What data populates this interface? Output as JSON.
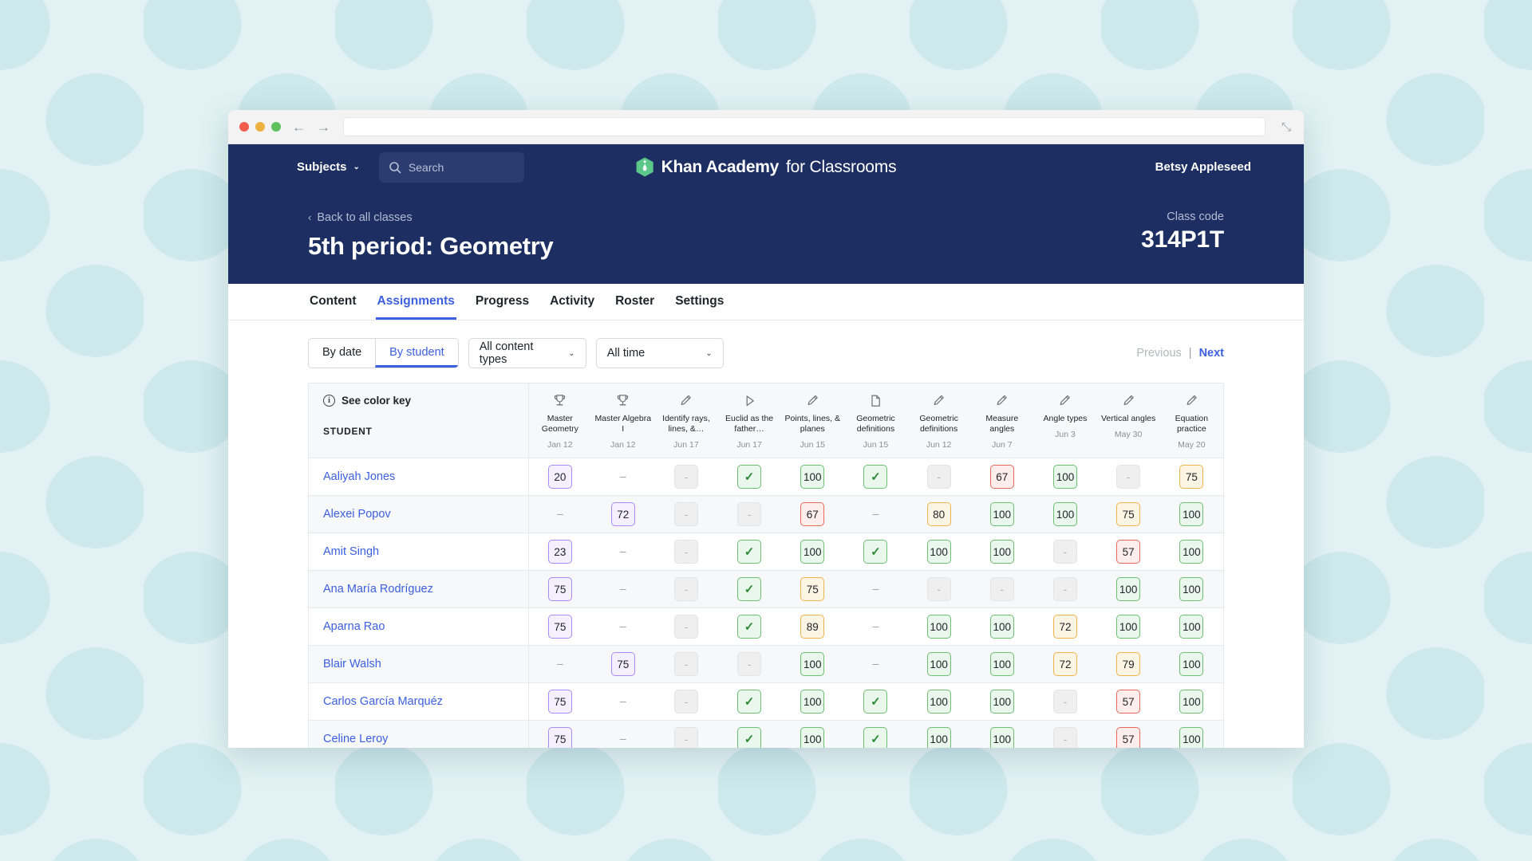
{
  "browser": {
    "traffic_lights": [
      "close-red",
      "minimize-yellow",
      "maximize-green"
    ],
    "back_arrow": "←",
    "forward_arrow": "→",
    "url_value": "",
    "expand_icon": "⤡"
  },
  "nav": {
    "subjects_label": "Subjects",
    "chevron": "⌄",
    "search_placeholder": "Search",
    "search_value": "",
    "brand_bold": "Khan Academy",
    "brand_light": "for Classrooms",
    "user_name": "Betsy Appleseed"
  },
  "class_header": {
    "back_chevron": "‹",
    "back_label": "Back to all classes",
    "title": "5th period: Geometry",
    "class_code_label": "Class code",
    "class_code_value": "314P1T"
  },
  "tabs": [
    {
      "label": "Content",
      "active": false
    },
    {
      "label": "Assignments",
      "active": true
    },
    {
      "label": "Progress",
      "active": false
    },
    {
      "label": "Activity",
      "active": false
    },
    {
      "label": "Roster",
      "active": false
    },
    {
      "label": "Settings",
      "active": false
    }
  ],
  "toolbar": {
    "by_date_label": "By date",
    "by_student_label": "By student",
    "content_type_value": "All content types",
    "time_value": "All time",
    "chevron": "⌄",
    "previous_label": "Previous",
    "separator": "|",
    "next_label": "Next"
  },
  "table": {
    "color_key_label": "See color key",
    "info_icon_glyph": "i",
    "student_column_label": "STUDENT",
    "columns": [
      {
        "icon": "trophy-icon",
        "name": "Master Geometry",
        "date": "Jan 12"
      },
      {
        "icon": "trophy-icon",
        "name": "Master Algebra I",
        "date": "Jan 12"
      },
      {
        "icon": "pencil-icon",
        "name": "Identify rays, lines, &…",
        "date": "Jun 17"
      },
      {
        "icon": "play-icon",
        "name": "Euclid as the father…",
        "date": "Jun 17"
      },
      {
        "icon": "pencil-icon",
        "name": "Points, lines, & planes",
        "date": "Jun 15"
      },
      {
        "icon": "article-icon",
        "name": "Geometric definitions",
        "date": "Jun 15"
      },
      {
        "icon": "pencil-icon",
        "name": "Geometric definitions",
        "date": "Jun 12"
      },
      {
        "icon": "pencil-icon",
        "name": "Measure angles",
        "date": "Jun 7"
      },
      {
        "icon": "pencil-icon",
        "name": "Angle types",
        "date": "Jun 3"
      },
      {
        "icon": "pencil-icon",
        "name": "Vertical angles",
        "date": "May 30"
      },
      {
        "icon": "pencil-icon",
        "name": "Equation practice",
        "date": "May 20"
      }
    ],
    "rows": [
      {
        "student": "Aaliyah Jones",
        "cells": [
          {
            "text": "20",
            "style": "purple"
          },
          {
            "text": "–",
            "style": "plain"
          },
          {
            "text": "-",
            "style": "gray"
          },
          {
            "text": "✓",
            "style": "green check"
          },
          {
            "text": "100",
            "style": "green"
          },
          {
            "text": "✓",
            "style": "green check"
          },
          {
            "text": "-",
            "style": "gray"
          },
          {
            "text": "67",
            "style": "red"
          },
          {
            "text": "100",
            "style": "green"
          },
          {
            "text": "-",
            "style": "gray"
          },
          {
            "text": "75",
            "style": "yellow"
          }
        ]
      },
      {
        "student": "Alexei Popov",
        "cells": [
          {
            "text": "–",
            "style": "plain"
          },
          {
            "text": "72",
            "style": "purple"
          },
          {
            "text": "-",
            "style": "gray"
          },
          {
            "text": "-",
            "style": "gray"
          },
          {
            "text": "67",
            "style": "red"
          },
          {
            "text": "–",
            "style": "plain"
          },
          {
            "text": "80",
            "style": "yellow"
          },
          {
            "text": "100",
            "style": "green"
          },
          {
            "text": "100",
            "style": "green"
          },
          {
            "text": "75",
            "style": "yellow"
          },
          {
            "text": "100",
            "style": "green"
          }
        ]
      },
      {
        "student": "Amit Singh",
        "cells": [
          {
            "text": "23",
            "style": "purple"
          },
          {
            "text": "–",
            "style": "plain"
          },
          {
            "text": "-",
            "style": "gray"
          },
          {
            "text": "✓",
            "style": "green check"
          },
          {
            "text": "100",
            "style": "green"
          },
          {
            "text": "✓",
            "style": "green check"
          },
          {
            "text": "100",
            "style": "green"
          },
          {
            "text": "100",
            "style": "green"
          },
          {
            "text": "-",
            "style": "gray"
          },
          {
            "text": "57",
            "style": "red"
          },
          {
            "text": "100",
            "style": "green"
          }
        ]
      },
      {
        "student": "Ana María Rodríguez",
        "cells": [
          {
            "text": "75",
            "style": "purple"
          },
          {
            "text": "–",
            "style": "plain"
          },
          {
            "text": "-",
            "style": "gray"
          },
          {
            "text": "✓",
            "style": "green check"
          },
          {
            "text": "75",
            "style": "yellow"
          },
          {
            "text": "–",
            "style": "plain"
          },
          {
            "text": "-",
            "style": "gray"
          },
          {
            "text": "-",
            "style": "gray"
          },
          {
            "text": "-",
            "style": "gray"
          },
          {
            "text": "100",
            "style": "green"
          },
          {
            "text": "100",
            "style": "green"
          }
        ]
      },
      {
        "student": "Aparna Rao",
        "cells": [
          {
            "text": "75",
            "style": "purple"
          },
          {
            "text": "–",
            "style": "plain"
          },
          {
            "text": "-",
            "style": "gray"
          },
          {
            "text": "✓",
            "style": "green check"
          },
          {
            "text": "89",
            "style": "yellow"
          },
          {
            "text": "–",
            "style": "plain"
          },
          {
            "text": "100",
            "style": "green"
          },
          {
            "text": "100",
            "style": "green"
          },
          {
            "text": "72",
            "style": "yellow"
          },
          {
            "text": "100",
            "style": "green"
          },
          {
            "text": "100",
            "style": "green"
          }
        ]
      },
      {
        "student": "Blair Walsh",
        "cells": [
          {
            "text": "–",
            "style": "plain"
          },
          {
            "text": "75",
            "style": "purple"
          },
          {
            "text": "-",
            "style": "gray"
          },
          {
            "text": "-",
            "style": "gray"
          },
          {
            "text": "100",
            "style": "green"
          },
          {
            "text": "–",
            "style": "plain"
          },
          {
            "text": "100",
            "style": "green"
          },
          {
            "text": "100",
            "style": "green"
          },
          {
            "text": "72",
            "style": "yellow"
          },
          {
            "text": "79",
            "style": "yellow"
          },
          {
            "text": "100",
            "style": "green"
          }
        ]
      },
      {
        "student": "Carlos García Marquéz",
        "cells": [
          {
            "text": "75",
            "style": "purple"
          },
          {
            "text": "–",
            "style": "plain"
          },
          {
            "text": "-",
            "style": "gray"
          },
          {
            "text": "✓",
            "style": "green check"
          },
          {
            "text": "100",
            "style": "green"
          },
          {
            "text": "✓",
            "style": "green check"
          },
          {
            "text": "100",
            "style": "green"
          },
          {
            "text": "100",
            "style": "green"
          },
          {
            "text": "-",
            "style": "gray"
          },
          {
            "text": "57",
            "style": "red"
          },
          {
            "text": "100",
            "style": "green"
          }
        ]
      },
      {
        "student": "Celine Leroy",
        "cells": [
          {
            "text": "75",
            "style": "purple"
          },
          {
            "text": "–",
            "style": "plain"
          },
          {
            "text": "-",
            "style": "gray"
          },
          {
            "text": "✓",
            "style": "green check"
          },
          {
            "text": "100",
            "style": "green"
          },
          {
            "text": "✓",
            "style": "green check"
          },
          {
            "text": "100",
            "style": "green"
          },
          {
            "text": "100",
            "style": "green"
          },
          {
            "text": "-",
            "style": "gray"
          },
          {
            "text": "57",
            "style": "red"
          },
          {
            "text": "100",
            "style": "green"
          }
        ]
      }
    ]
  },
  "colors": {
    "brand_navy": "#1d2e62",
    "accent_blue": "#3b5fe0",
    "logo_green": "#5bc88a",
    "chip_purple": "#a78bfa",
    "chip_green": "#6cbf73",
    "chip_yellow": "#f1b44c",
    "chip_red": "#e8695c",
    "page_background": "#e2f2f4"
  }
}
